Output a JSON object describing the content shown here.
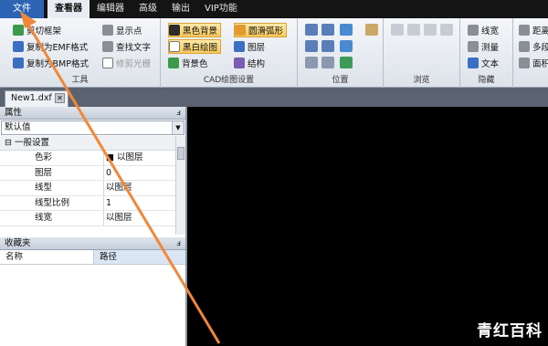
{
  "menu": {
    "file": "文件",
    "items": [
      "查看器",
      "编辑器",
      "高级",
      "输出",
      "VIP功能"
    ]
  },
  "ribbon": {
    "tools": {
      "label": "工具",
      "items": [
        "剪切框架",
        "复制为EMF格式",
        "复制为BMP格式",
        "显示点",
        "查找文字",
        "修剪光栅"
      ]
    },
    "cad": {
      "label": "CAD绘图设置",
      "items": [
        "黑色背景",
        "黑白绘图",
        "背景色",
        "圆滑弧形",
        "图层",
        "结构"
      ]
    },
    "position": {
      "label": "位置"
    },
    "browse": {
      "label": "浏览"
    },
    "hide": {
      "label": "隐藏",
      "items": [
        "线宽",
        "测量",
        "文本"
      ]
    },
    "extra": {
      "items": [
        "距离",
        "多段",
        "面积"
      ]
    }
  },
  "document": {
    "tab": "New1.dxf"
  },
  "properties": {
    "title": "属性",
    "combo": "默认值",
    "category": "一般设置",
    "rows": [
      {
        "key": "色彩",
        "value": "■ 以图层"
      },
      {
        "key": "图层",
        "value": "0"
      },
      {
        "key": "线型",
        "value": "以图层"
      },
      {
        "key": "线型比例",
        "value": "1"
      },
      {
        "key": "线宽",
        "value": "以图层"
      }
    ]
  },
  "favorites": {
    "title": "收藏夹",
    "col_name": "名称",
    "col_path": "路径"
  },
  "watermark": "青红百科",
  "colors": {
    "menu_bg": "#141414",
    "file_tab": "#2e64b4",
    "ribbon_bg": "#e4e9ef",
    "arrow": "#f0883a",
    "canvas": "#000000"
  }
}
